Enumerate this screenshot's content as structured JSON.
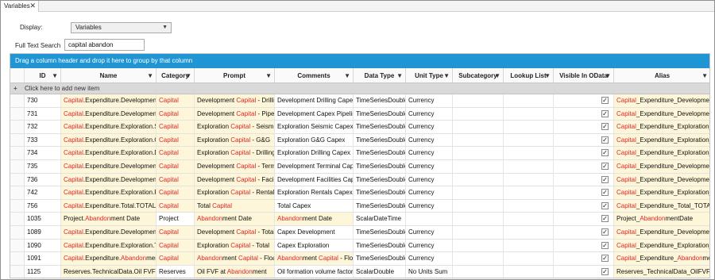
{
  "tab": {
    "title": "Variables",
    "close_glyph": "✕"
  },
  "display": {
    "label": "Display:",
    "value": "Variables"
  },
  "search": {
    "label": "Full Text Search",
    "value": "capital abandon"
  },
  "grid": {
    "group_hint": "Drag a column header and drop it here to group by that column",
    "add_item": "Click here to add new item",
    "columns": [
      "ID",
      "Name",
      "Category",
      "Prompt",
      "Comments",
      "Data Type",
      "Unit Type",
      "Subcategory",
      "Lookup List",
      "Visible In OData",
      "Alias"
    ],
    "filter_glyph": "▼",
    "check_glyph": "✓",
    "highlight_color": "#e0262a",
    "rows": [
      {
        "id": "730",
        "name": [
          [
            "Capital",
            "h"
          ],
          [
            ".Expenditure.Development.",
            ""
          ]
        ],
        "category": [
          [
            "Capital",
            "h"
          ]
        ],
        "prompt": [
          [
            "Development ",
            ""
          ],
          [
            "Capital",
            "h"
          ],
          [
            " - Drilli",
            ""
          ]
        ],
        "comments": [
          [
            "Development Drilling Capex",
            ""
          ]
        ],
        "datatype": "TimeSeriesDouble",
        "unittype": "Currency",
        "visible": true,
        "alias": [
          [
            "Capital",
            "h"
          ],
          [
            "_Expenditure_Development",
            ""
          ]
        ]
      },
      {
        "id": "731",
        "name": [
          [
            "Capital",
            "h"
          ],
          [
            ".Expenditure.Development.",
            ""
          ]
        ],
        "category": [
          [
            "Capital",
            "h"
          ]
        ],
        "prompt": [
          [
            "Development ",
            ""
          ],
          [
            "Capital",
            "h"
          ],
          [
            " - Pipeli",
            ""
          ]
        ],
        "comments": [
          [
            "Development Capex Pipeline",
            ""
          ]
        ],
        "datatype": "TimeSeriesDouble",
        "unittype": "Currency",
        "visible": true,
        "alias": [
          [
            "Capital",
            "h"
          ],
          [
            "_Expenditure_Development",
            ""
          ]
        ]
      },
      {
        "id": "732",
        "name": [
          [
            "Capital",
            "h"
          ],
          [
            ".Expenditure.Exploration.Se",
            ""
          ]
        ],
        "category": [
          [
            "Capital",
            "h"
          ]
        ],
        "prompt": [
          [
            "Exploration ",
            ""
          ],
          [
            "Capital",
            "h"
          ],
          [
            " - Seismic",
            ""
          ]
        ],
        "comments": [
          [
            "Exploration Seismic Capex",
            ""
          ]
        ],
        "datatype": "TimeSeriesDouble",
        "unittype": "Currency",
        "visible": true,
        "alias": [
          [
            "Capital",
            "h"
          ],
          [
            "_Expenditure_Exploration_S",
            ""
          ]
        ]
      },
      {
        "id": "733",
        "name": [
          [
            "Capital",
            "h"
          ],
          [
            ".Expenditure.Exploration.G&",
            ""
          ]
        ],
        "category": [
          [
            "Capital",
            "h"
          ]
        ],
        "prompt": [
          [
            "Exploration ",
            ""
          ],
          [
            "Capital",
            "h"
          ],
          [
            " - G&G",
            ""
          ]
        ],
        "comments": [
          [
            "Exploration G&G Capex",
            ""
          ]
        ],
        "datatype": "TimeSeriesDouble",
        "unittype": "Currency",
        "visible": true,
        "alias": [
          [
            "Capital",
            "h"
          ],
          [
            "_Expenditure_Exploration_G",
            ""
          ]
        ]
      },
      {
        "id": "734",
        "name": [
          [
            "Capital",
            "h"
          ],
          [
            ".Expenditure.Exploration.Dr",
            ""
          ]
        ],
        "category": [
          [
            "Capital",
            "h"
          ]
        ],
        "prompt": [
          [
            "Exploration ",
            ""
          ],
          [
            "Capital",
            "h"
          ],
          [
            " - Drilling",
            ""
          ]
        ],
        "comments": [
          [
            "Exploration Drilling Capex",
            ""
          ]
        ],
        "datatype": "TimeSeriesDouble",
        "unittype": "Currency",
        "visible": true,
        "alias": [
          [
            "Capital",
            "h"
          ],
          [
            "_Expenditure_Exploration_D",
            ""
          ]
        ]
      },
      {
        "id": "735",
        "name": [
          [
            "Capital",
            "h"
          ],
          [
            ".Expenditure.Development.",
            ""
          ]
        ],
        "category": [
          [
            "Capital",
            "h"
          ]
        ],
        "prompt": [
          [
            "Development ",
            ""
          ],
          [
            "Capital",
            "h"
          ],
          [
            " - Termi",
            ""
          ]
        ],
        "comments": [
          [
            "Development Terminal Capex",
            ""
          ]
        ],
        "datatype": "TimeSeriesDouble",
        "unittype": "Currency",
        "visible": true,
        "alias": [
          [
            "Capital",
            "h"
          ],
          [
            "_Expenditure_Development",
            ""
          ]
        ]
      },
      {
        "id": "736",
        "name": [
          [
            "Capital",
            "h"
          ],
          [
            ".Expenditure.Development.",
            ""
          ]
        ],
        "category": [
          [
            "Capital",
            "h"
          ]
        ],
        "prompt": [
          [
            "Development ",
            ""
          ],
          [
            "Capital",
            "h"
          ],
          [
            " - Facili",
            ""
          ]
        ],
        "comments": [
          [
            "Development Facilities Capex",
            ""
          ]
        ],
        "datatype": "TimeSeriesDouble",
        "unittype": "Currency",
        "visible": true,
        "alias": [
          [
            "Capital",
            "h"
          ],
          [
            "_Expenditure_Development",
            ""
          ]
        ]
      },
      {
        "id": "742",
        "name": [
          [
            "Capital",
            "h"
          ],
          [
            ".Expenditure.Exploration.Re",
            ""
          ]
        ],
        "category": [
          [
            "Capital",
            "h"
          ]
        ],
        "prompt": [
          [
            "Exploration ",
            ""
          ],
          [
            "Capital",
            "h"
          ],
          [
            " - Rentals",
            ""
          ]
        ],
        "comments": [
          [
            "Exploration Rentals Capex",
            ""
          ]
        ],
        "datatype": "TimeSeriesDouble",
        "unittype": "Currency",
        "visible": true,
        "alias": [
          [
            "Capital",
            "h"
          ],
          [
            "_Expenditure_Exploration_R",
            ""
          ]
        ]
      },
      {
        "id": "756",
        "name": [
          [
            "Capital",
            "h"
          ],
          [
            ".Expenditure.Total.TOTAL",
            ""
          ]
        ],
        "category": [
          [
            "Capital",
            "h"
          ]
        ],
        "prompt": [
          [
            "Total ",
            ""
          ],
          [
            "Capital",
            "h"
          ]
        ],
        "comments": [
          [
            "Total Capex",
            ""
          ]
        ],
        "datatype": "TimeSeriesDouble",
        "unittype": "Currency",
        "visible": true,
        "alias": [
          [
            "Capital",
            "h"
          ],
          [
            "_Expenditure_Total_TOTAL",
            ""
          ]
        ]
      },
      {
        "id": "1035",
        "name": [
          [
            "Project.",
            ""
          ],
          [
            "Abandon",
            "h"
          ],
          [
            "ment Date",
            ""
          ]
        ],
        "category": [
          [
            "Project",
            ""
          ]
        ],
        "prompt": [
          [
            "Abandon",
            "h"
          ],
          [
            "ment Date",
            ""
          ]
        ],
        "comments": [
          [
            "Abandon",
            "h"
          ],
          [
            "ment Date",
            ""
          ]
        ],
        "datatype": "ScalarDateTime",
        "unittype": "",
        "visible": true,
        "alias": [
          [
            "Project_",
            ""
          ],
          [
            "Abandon",
            "h"
          ],
          [
            "mentDate",
            ""
          ]
        ]
      },
      {
        "id": "1089",
        "name": [
          [
            "Capital",
            "h"
          ],
          [
            ".Expenditure.Development.",
            ""
          ]
        ],
        "category": [
          [
            "Capital",
            "h"
          ]
        ],
        "prompt": [
          [
            "Development ",
            ""
          ],
          [
            "Capital",
            "h"
          ],
          [
            " - Total",
            ""
          ]
        ],
        "comments": [
          [
            "Capex Development",
            ""
          ]
        ],
        "datatype": "TimeSeriesDouble",
        "unittype": "Currency",
        "visible": true,
        "alias": [
          [
            "Capital",
            "h"
          ],
          [
            "_Expenditure_Development",
            ""
          ]
        ]
      },
      {
        "id": "1090",
        "name": [
          [
            "Capital",
            "h"
          ],
          [
            ".Expenditure.Exploration.To",
            ""
          ]
        ],
        "category": [
          [
            "Capital",
            "h"
          ]
        ],
        "prompt": [
          [
            "Exploration ",
            ""
          ],
          [
            "Capital",
            "h"
          ],
          [
            " - Total",
            ""
          ]
        ],
        "comments": [
          [
            "Capex Exploration",
            ""
          ]
        ],
        "datatype": "TimeSeriesDouble",
        "unittype": "Currency",
        "visible": true,
        "alias": [
          [
            "Capital",
            "h"
          ],
          [
            "_Expenditure_Exploration_T",
            ""
          ]
        ]
      },
      {
        "id": "1091",
        "name": [
          [
            "Capital",
            "h"
          ],
          [
            ".Expenditure.",
            ""
          ],
          [
            "Abandon",
            "h"
          ],
          [
            "ment",
            ""
          ]
        ],
        "category": [
          [
            "Capital",
            "h"
          ]
        ],
        "prompt": [
          [
            "Abandon",
            "h"
          ],
          [
            "ment ",
            ""
          ],
          [
            "Capital",
            "h"
          ],
          [
            " - Floa",
            ""
          ]
        ],
        "comments": [
          [
            "Abandon",
            "h"
          ],
          [
            "ment ",
            ""
          ],
          [
            "Capital",
            "h"
          ],
          [
            " - Floa",
            ""
          ]
        ],
        "datatype": "TimeSeriesDouble",
        "unittype": "Currency",
        "visible": true,
        "alias": [
          [
            "Capital",
            "h"
          ],
          [
            "_Expenditure_",
            ""
          ],
          [
            "Abandon",
            "h"
          ],
          [
            "men",
            ""
          ]
        ]
      },
      {
        "id": "1125",
        "name": [
          [
            "Reserves.TechnicalData.Oil FVF ",
            ""
          ],
          [
            "Ab",
            "h"
          ]
        ],
        "category": [
          [
            "Reserves",
            ""
          ]
        ],
        "prompt": [
          [
            "Oil FVF at ",
            ""
          ],
          [
            "Abandon",
            "h"
          ],
          [
            "ment",
            ""
          ]
        ],
        "comments": [
          [
            "Oil formation volume factor",
            ""
          ]
        ],
        "datatype": "ScalarDouble",
        "unittype": "No Units Sum",
        "visible": true,
        "alias": [
          [
            "Reserves_TechnicalData_OilFVF",
            ""
          ],
          [
            "Ab",
            "h"
          ]
        ]
      }
    ]
  }
}
